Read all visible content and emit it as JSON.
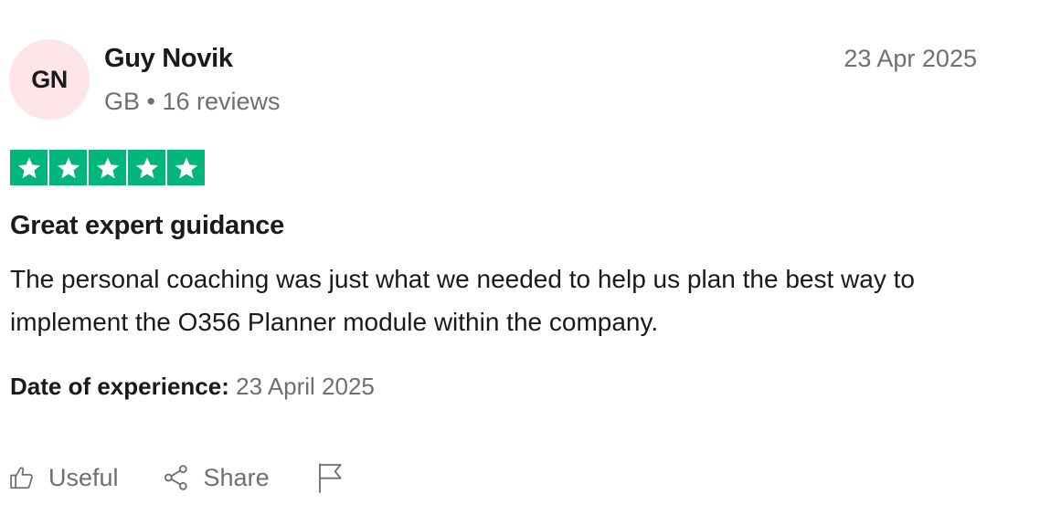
{
  "reviewer": {
    "initials": "GN",
    "name": "Guy Novik",
    "country": "GB",
    "separator": "•",
    "reviews_count": "16 reviews",
    "avatar_color": "#fde4e6"
  },
  "review": {
    "date": "23 Apr 2025",
    "rating": 5,
    "rating_max": 5,
    "star_color": "#00b67a",
    "title": "Great expert guidance",
    "body": "The personal coaching was just what we needed to help us plan the best way to implement the O356 Planner module within the company.",
    "experience_label": "Date of experience:",
    "experience_date": "23 April 2025"
  },
  "actions": {
    "useful_label": "Useful",
    "useful_icon": "thumbs-up-icon",
    "share_label": "Share",
    "share_icon": "share-icon",
    "report_icon": "flag-icon"
  }
}
